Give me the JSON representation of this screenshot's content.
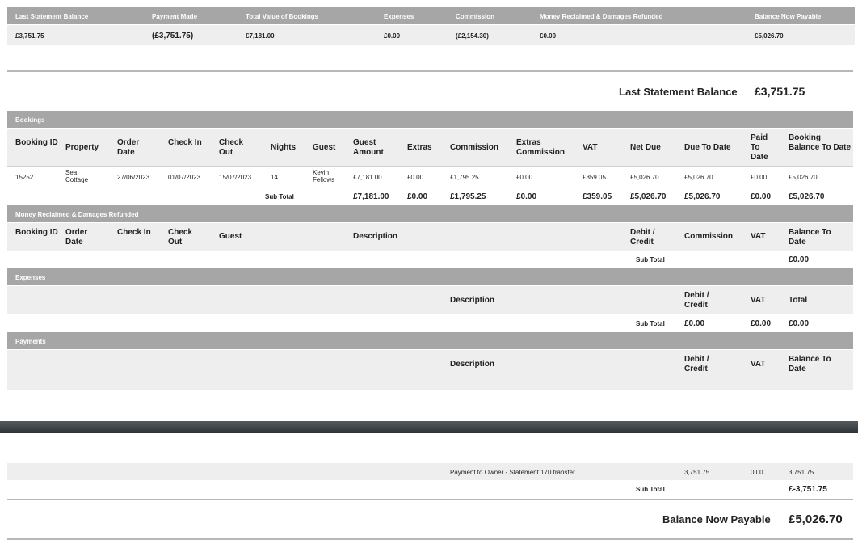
{
  "summary": {
    "headers": [
      "Last Statement Balance",
      "Payment Made",
      "Total Value of Bookings",
      "Expenses",
      "Commission",
      "Money Reclaimed & Damages Refunded",
      "Balance Now Payable"
    ],
    "values": [
      "£3,751.75",
      "(£3,751.75)",
      "£7,181.00",
      "£0.00",
      "(£2,154.30)",
      "£0.00",
      "£5,026.70"
    ]
  },
  "last_statement": {
    "label": "Last Statement Balance",
    "value": "£3,751.75"
  },
  "bookings": {
    "title": "Bookings",
    "columns": [
      "Booking ID",
      "Property",
      "Order Date",
      "Check In",
      "Check Out",
      "Nights",
      "Guest",
      "Guest Amount",
      "Extras",
      "Commission",
      "Extras Commission",
      "VAT",
      "Net Due",
      "Due To Date",
      "Paid To Date",
      "Booking Balance To Date"
    ],
    "rows": [
      [
        "15252",
        "Sea Cottage",
        "27/06/2023",
        "01/07/2023",
        "15/07/2023",
        "14",
        "Kevin Fellows",
        "£7,181.00",
        "£0.00",
        "£1,795.25",
        "£0.00",
        "£359.05",
        "£5,026.70",
        "£5,026.70",
        "£0.00",
        "£5,026.70"
      ]
    ],
    "subtotal_label": "Sub Total",
    "subtotals": [
      "£7,181.00",
      "£0.00",
      "£1,795.25",
      "£0.00",
      "£359.05",
      "£5,026.70",
      "£5,026.70",
      "£0.00",
      "£5,026.70"
    ]
  },
  "reclaimed": {
    "title": "Money Reclaimed & Damages Refunded",
    "columns": [
      "Booking ID",
      "Order Date",
      "Check In",
      "Check Out",
      "Guest",
      "Description",
      "Debit / Credit",
      "Commission",
      "VAT",
      "Balance To Date"
    ],
    "subtotal_label": "Sub Total",
    "subtotal_balance": "£0.00"
  },
  "expenses": {
    "title": "Expenses",
    "columns": [
      "Description",
      "Debit / Credit",
      "VAT",
      "Total"
    ],
    "subtotal_label": "Sub Total",
    "subtotals": [
      "£0.00",
      "£0.00",
      "£0.00"
    ]
  },
  "payments": {
    "title": "Payments",
    "columns": [
      "Description",
      "Debit / Credit",
      "VAT",
      "Balance To Date"
    ],
    "rows": [
      [
        "Payment to Owner - Statement 170 transfer",
        "3,751.75",
        "0.00",
        "3,751.75"
      ]
    ],
    "subtotal_label": "Sub Total",
    "subtotal_balance": "£-3,751.75"
  },
  "balance_now": {
    "label": "Balance Now Payable",
    "value": "£5,026.70"
  }
}
